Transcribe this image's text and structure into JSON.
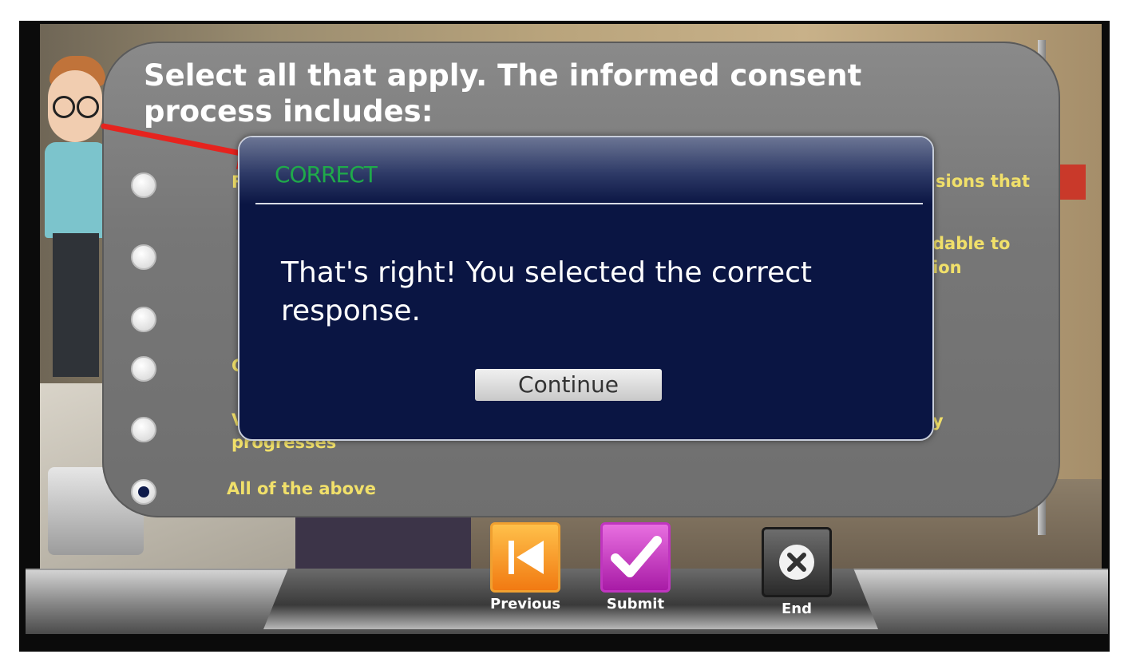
{
  "question": {
    "text": "Select all that apply. The informed consent process includes:",
    "options": [
      {
        "label": "F",
        "right_text": "sions that",
        "selected": false
      },
      {
        "label": "",
        "right_text": "dable to\nion",
        "selected": false
      },
      {
        "label": "",
        "right_text": "",
        "selected": false
      },
      {
        "label": "C",
        "right_text": "",
        "selected": false
      },
      {
        "label": "V\nprogresses",
        "right_text": "y",
        "selected": false
      },
      {
        "label": "All of the above",
        "right_text": "",
        "selected": true
      }
    ]
  },
  "dialog": {
    "title": "CORRECT",
    "message": "That's right!  You selected the correct response.",
    "continue_label": "Continue"
  },
  "nav": {
    "previous_label": "Previous",
    "submit_label": "Submit",
    "end_label": "End"
  },
  "colors": {
    "correct_title": "#1faa4a",
    "option_text": "#f1e06a",
    "dialog_bg": "#0a1543",
    "arrow": "#e6231e"
  }
}
